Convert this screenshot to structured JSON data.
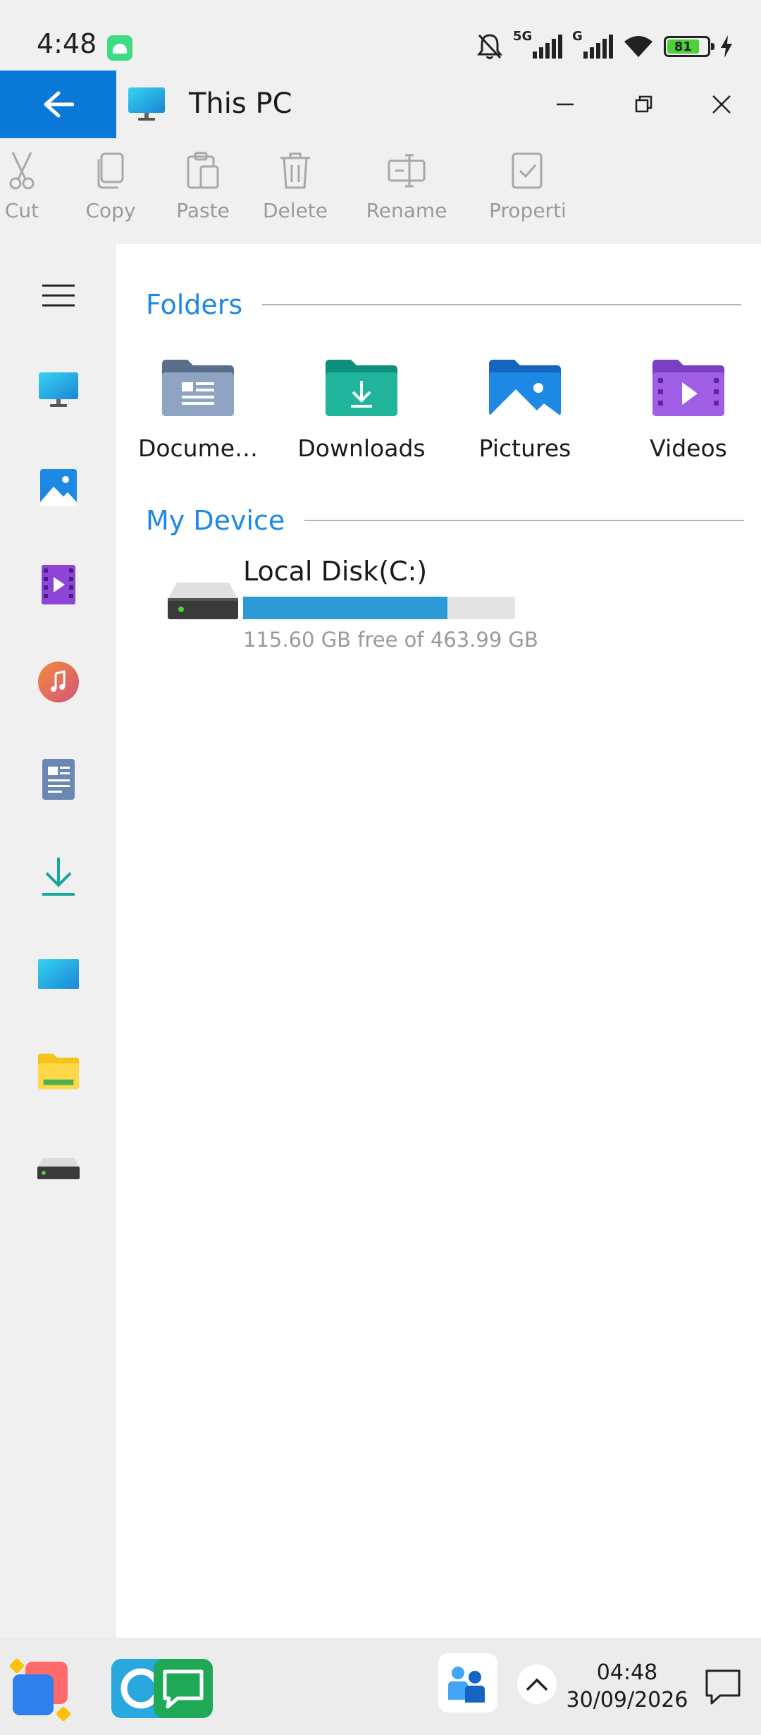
{
  "status": {
    "time": "4:48",
    "net1": "5G",
    "net2": "G",
    "battery": "81"
  },
  "window": {
    "title": "This PC"
  },
  "ribbon": {
    "items": [
      {
        "label": "Cut"
      },
      {
        "label": "Copy"
      },
      {
        "label": "Paste"
      },
      {
        "label": "Delete"
      },
      {
        "label": "Rename"
      },
      {
        "label": "Properti"
      }
    ]
  },
  "sections": {
    "folders": "Folders",
    "device": "My Device"
  },
  "folders": [
    {
      "label": "Docume…",
      "icon": "documents-folder-icon"
    },
    {
      "label": "Downloads",
      "icon": "downloads-folder-icon"
    },
    {
      "label": "Pictures",
      "icon": "pictures-folder-icon"
    },
    {
      "label": "Videos",
      "icon": "videos-folder-icon"
    }
  ],
  "disk": {
    "name": "Local Disk(C:)",
    "free_text": "115.60 GB free of 463.99 GB",
    "used_fraction": 0.751
  },
  "taskbar": {
    "time": "04:48",
    "date": "30/09/2026"
  },
  "colors": {
    "accent": "#0a78d7",
    "section": "#1e88e5",
    "disk_bar": "#2a9bd6"
  }
}
